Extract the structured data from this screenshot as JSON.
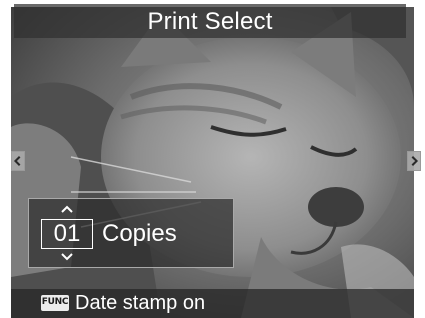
{
  "header": {
    "title": "Print Select"
  },
  "navigation": {
    "previous_icon": "chevron-left-icon",
    "next_icon": "chevron-right-icon"
  },
  "copies": {
    "value": "01",
    "label": "Copies",
    "increase_icon": "chevron-up-icon",
    "decrease_icon": "chevron-down-icon"
  },
  "footer": {
    "func_key": "FUNC",
    "hint": "Date stamp on"
  },
  "colors": {
    "overlay": "#303030",
    "text": "#ffffff",
    "func_badge": "#ececec"
  }
}
